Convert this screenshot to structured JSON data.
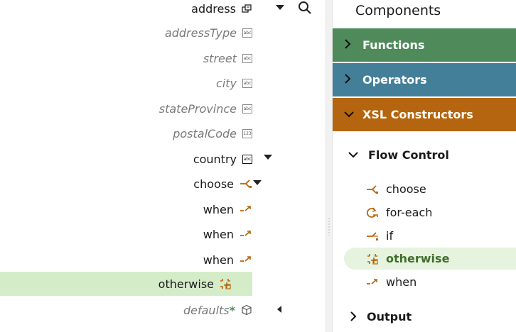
{
  "mapping_tree": {
    "rows": [
      {
        "label": "address",
        "style": "node",
        "icon": "object-icon",
        "expand": "collapse-caret"
      },
      {
        "label": "addressType",
        "style": "leaf",
        "icon": "string-type-icon",
        "type_text": "abc"
      },
      {
        "label": "street",
        "style": "leaf",
        "icon": "string-type-icon",
        "type_text": "abc"
      },
      {
        "label": "city",
        "style": "leaf",
        "icon": "string-type-icon",
        "type_text": "abc"
      },
      {
        "label": "stateProvince",
        "style": "leaf",
        "icon": "string-type-icon",
        "type_text": "abc"
      },
      {
        "label": "postalCode",
        "style": "leaf",
        "icon": "number-type-icon",
        "type_text": "123"
      },
      {
        "label": "country",
        "style": "node",
        "icon": "string-type-icon",
        "type_text": "abc"
      },
      {
        "label": "choose",
        "style": "node",
        "icon": "choose-icon"
      },
      {
        "label": "when",
        "style": "node",
        "icon": "when-icon"
      },
      {
        "label": "when",
        "style": "node",
        "icon": "when-icon"
      },
      {
        "label": "when",
        "style": "node",
        "icon": "when-icon"
      },
      {
        "label": "otherwise",
        "style": "node",
        "icon": "otherwise-icon",
        "selected": true
      },
      {
        "label": "defaults",
        "style": "leaf",
        "icon": "cube-icon",
        "required_marker": "*"
      }
    ]
  },
  "components": {
    "title": "Components",
    "sections": [
      {
        "label": "Functions",
        "color": "#4e8a5a",
        "state": "collapsed"
      },
      {
        "label": "Operators",
        "color": "#447f99",
        "state": "collapsed"
      },
      {
        "label": "XSL Constructors",
        "color": "#b5650f",
        "state": "expanded"
      }
    ],
    "flow_control": {
      "label": "Flow Control",
      "items": [
        {
          "label": "choose",
          "icon": "choose-icon"
        },
        {
          "label": "for-each",
          "icon": "for-each-icon"
        },
        {
          "label": "if",
          "icon": "if-icon"
        },
        {
          "label": "otherwise",
          "icon": "otherwise-icon",
          "selected": true
        },
        {
          "label": "when",
          "icon": "when-icon"
        }
      ]
    },
    "output": {
      "label": "Output"
    }
  },
  "colors": {
    "accent_orange": "#b5650f",
    "selection_green": "#d5ecc9",
    "functions": "#4e8a5a",
    "operators": "#447f99",
    "xsl_constructors": "#b5650f"
  }
}
